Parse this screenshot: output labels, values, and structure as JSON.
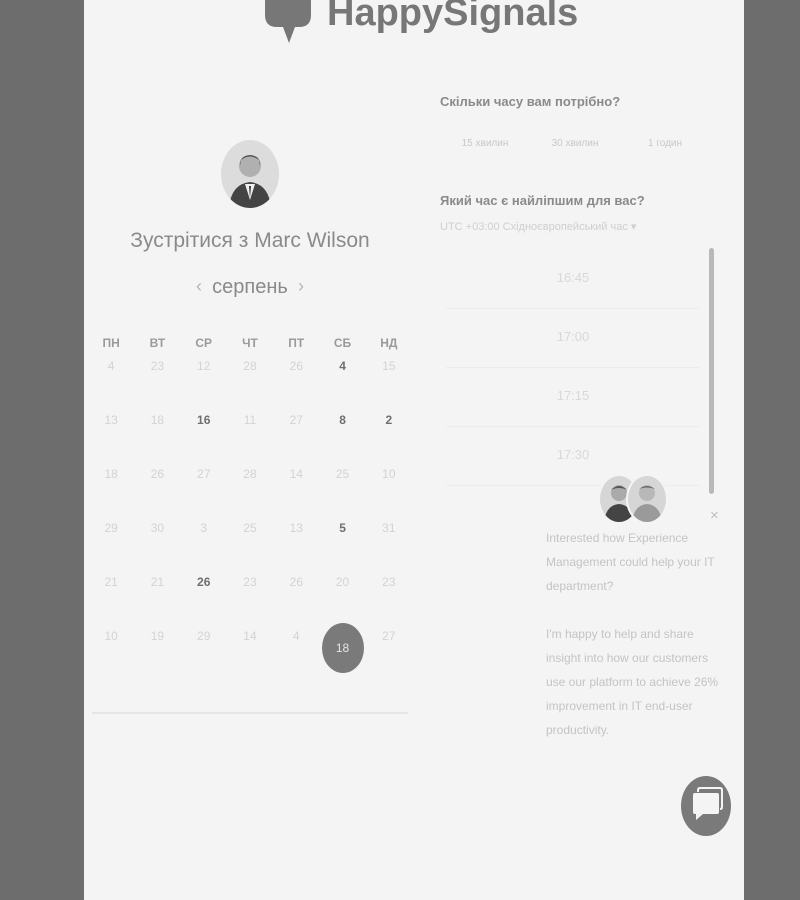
{
  "brand": {
    "name": "HappySignals"
  },
  "scheduler": {
    "title": "Зустрітися з Marc Wilson",
    "month": "серпень",
    "weekdays": [
      "ПН",
      "ВТ",
      "СР",
      "ЧТ",
      "ПТ",
      "СБ",
      "НД"
    ],
    "weeks": [
      [
        {
          "d": "4"
        },
        {
          "d": "23"
        },
        {
          "d": "12"
        },
        {
          "d": "28"
        },
        {
          "d": "26"
        },
        {
          "d": "4",
          "avail": true
        },
        {
          "d": "15"
        }
      ],
      [
        {
          "d": "13"
        },
        {
          "d": "18"
        },
        {
          "d": "16",
          "avail": true
        },
        {
          "d": "11"
        },
        {
          "d": "27"
        },
        {
          "d": "8",
          "avail": true
        },
        {
          "d": "2",
          "avail": true
        }
      ],
      [
        {
          "d": "18"
        },
        {
          "d": "26"
        },
        {
          "d": "27"
        },
        {
          "d": "28"
        },
        {
          "d": "14"
        },
        {
          "d": "25"
        },
        {
          "d": "10"
        }
      ],
      [
        {
          "d": "29"
        },
        {
          "d": "30"
        },
        {
          "d": "3"
        },
        {
          "d": "25"
        },
        {
          "d": "13"
        },
        {
          "d": "5",
          "avail": true
        },
        {
          "d": "31"
        }
      ],
      [
        {
          "d": "21"
        },
        {
          "d": "21"
        },
        {
          "d": "26",
          "avail": true
        },
        {
          "d": "23"
        },
        {
          "d": "26"
        },
        {
          "d": "20"
        },
        {
          "d": "23"
        }
      ],
      [
        {
          "d": "10"
        },
        {
          "d": "19"
        },
        {
          "d": "29"
        },
        {
          "d": "14"
        },
        {
          "d": "4"
        },
        {
          "d": "18",
          "selected": true
        },
        {
          "d": "27"
        }
      ]
    ]
  },
  "booking": {
    "duration_question": "Скільки часу вам потрібно?",
    "durations": [
      "15 хвилин",
      "30 хвилин",
      "1 годин"
    ],
    "time_question": "Який час є найліпшим для вас?",
    "timezone": "UTC +03:00 Східноєвропейський час ▾",
    "slots": [
      "16:45",
      "17:00",
      "17:15",
      "17:30"
    ]
  },
  "chat": {
    "message_1": "Interested how Experience Management could help your IT department?",
    "message_2": "I'm happy to help and share insight into how our customers use our platform to achieve 26% improvement in IT end-user productivity.",
    "close_icon": "×"
  }
}
